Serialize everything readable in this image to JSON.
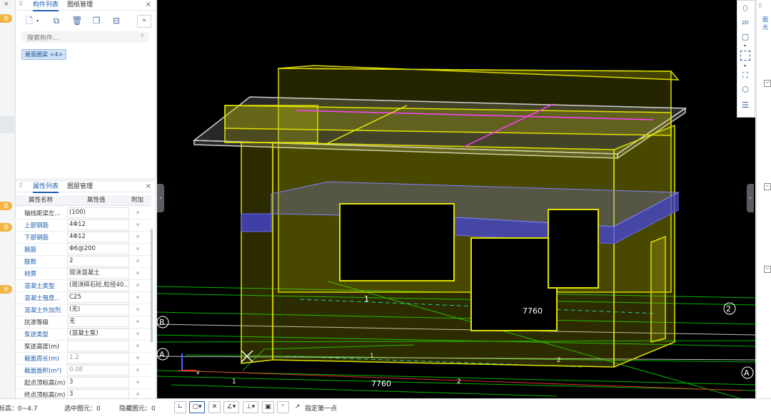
{
  "left_strip": {
    "close": "×",
    "badges": [
      "验",
      "验",
      "验",
      "验"
    ]
  },
  "component_panel": {
    "tabs": [
      "构件列表",
      "图纸管理"
    ],
    "close": "×",
    "more_button": "»",
    "search_placeholder": "搜索构件...",
    "selected_component": "屋面圈梁 <4>"
  },
  "property_panel": {
    "tabs": [
      "属性列表",
      "图层管理"
    ],
    "close": "×",
    "columns": [
      "属性名称",
      "属性值",
      "附加"
    ],
    "rows": [
      {
        "name": "轴线距梁左...",
        "value": "(100)",
        "blue": false,
        "gray": false
      },
      {
        "name": "上部钢筋",
        "value": "4Φ12",
        "blue": true,
        "gray": false
      },
      {
        "name": "下部钢筋",
        "value": "4Φ12",
        "blue": true,
        "gray": false
      },
      {
        "name": "箍筋",
        "value": "Φ6@200",
        "blue": true,
        "gray": false
      },
      {
        "name": "肢数",
        "value": "2",
        "blue": true,
        "gray": false
      },
      {
        "name": "材质",
        "value": "现浇混凝土",
        "blue": true,
        "gray": false
      },
      {
        "name": "混凝土类型",
        "value": "(现浇碎石砼,粒径40...",
        "blue": true,
        "gray": false
      },
      {
        "name": "混凝土强度...",
        "value": "C25",
        "blue": true,
        "gray": false
      },
      {
        "name": "混凝土外加剂",
        "value": "(无)",
        "blue": true,
        "gray": false
      },
      {
        "name": "抗渗等级",
        "value": "无",
        "blue": false,
        "gray": false
      },
      {
        "name": "泵送类型",
        "value": "(混凝土泵)",
        "blue": true,
        "gray": false
      },
      {
        "name": "泵送高度(m)",
        "value": "",
        "blue": false,
        "gray": false
      },
      {
        "name": "截面周长(m)",
        "value": "1.2",
        "blue": true,
        "gray": true
      },
      {
        "name": "截面面积(m²)",
        "value": "0.08",
        "blue": true,
        "gray": true
      },
      {
        "name": "起点顶标高(m)",
        "value": "3",
        "blue": false,
        "gray": false
      },
      {
        "name": "终点顶标高(m)",
        "value": "3",
        "blue": false,
        "gray": false
      }
    ]
  },
  "viewport": {
    "dimension_labels": [
      "7760",
      "7760"
    ],
    "axis_labels": [
      "1",
      "2",
      "A",
      "B",
      "1",
      "2",
      "A",
      "B"
    ]
  },
  "right_panel": {
    "tab": "图元",
    "boxes": [
      "−",
      "−",
      "−"
    ]
  },
  "status_bar": {
    "elevation": "标高：0~4.7",
    "selected": "选中图元：0",
    "hidden": "隐藏图元：0",
    "hint": "指定第一点"
  },
  "colors": {
    "accent": "#1a5fb4",
    "wall": "#c8c800",
    "beam": "#3b3bc8",
    "grid": "#00c800"
  }
}
